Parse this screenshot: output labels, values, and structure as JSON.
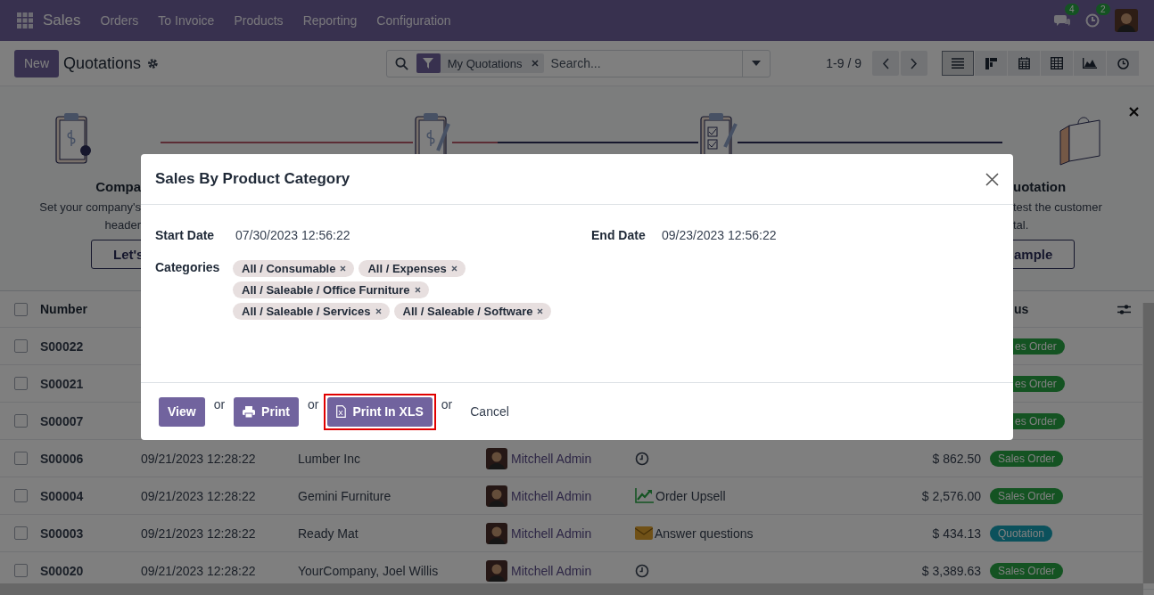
{
  "navbar": {
    "app": "Sales",
    "menu": [
      "Orders",
      "To Invoice",
      "Products",
      "Reporting",
      "Configuration"
    ],
    "messages_count": "4",
    "activities_count": "2"
  },
  "control_panel": {
    "new_button": "New",
    "title": "Quotations",
    "search": {
      "facet": "My Quotations",
      "placeholder": "Search..."
    },
    "pager": "1-9 / 9",
    "views": [
      {
        "kind": "list",
        "selected": true
      },
      {
        "kind": "kanban",
        "selected": false
      },
      {
        "kind": "calendar",
        "selected": false
      },
      {
        "kind": "pivot",
        "selected": false
      },
      {
        "kind": "graph",
        "selected": false
      },
      {
        "kind": "activity",
        "selected": false
      }
    ]
  },
  "onboarding_banner": {
    "left_step": {
      "title": "Compa",
      "description": [
        "Set your company's",
        "header"
      ],
      "button": "Let's"
    },
    "right_step": {
      "title": "uotation",
      "description": [
        "test the customer",
        "tal."
      ],
      "button": "ample"
    }
  },
  "table": {
    "select_all_checked": false,
    "columns": [
      "Number",
      "us"
    ],
    "rows": [
      {
        "checked": false,
        "number": "S00022",
        "status": {
          "kind": "sales_order",
          "label": "es Order",
          "partial": true
        }
      },
      {
        "checked": false,
        "number": "S00021",
        "status": {
          "kind": "sales_order",
          "label": "es Order",
          "partial": true
        }
      },
      {
        "checked": false,
        "number": "S00007",
        "status": {
          "kind": "sales_order",
          "label": "es Order",
          "partial": true
        }
      },
      {
        "checked": false,
        "number": "S00006",
        "date": "09/21/2023 12:28:22",
        "customer": "Lumber Inc",
        "salesperson": "Mitchell Admin",
        "activity": {
          "kind": "clock"
        },
        "total": "$ 862.50",
        "status": {
          "kind": "sales_order",
          "label": "Sales Order",
          "partial": false
        }
      },
      {
        "checked": false,
        "number": "S00004",
        "date": "09/21/2023 12:28:22",
        "customer": "Gemini Furniture",
        "salesperson": "Mitchell Admin",
        "activity": {
          "kind": "upsell",
          "label": "Order Upsell"
        },
        "total": "$ 2,576.00",
        "status": {
          "kind": "sales_order",
          "label": "Sales Order",
          "partial": false
        }
      },
      {
        "checked": false,
        "number": "S00003",
        "date": "09/21/2023 12:28:22",
        "customer": "Ready Mat",
        "salesperson": "Mitchell Admin",
        "activity": {
          "kind": "email",
          "label": "Answer questions"
        },
        "total": "$ 434.13",
        "status": {
          "kind": "quotation",
          "label": "Quotation",
          "partial": false
        }
      },
      {
        "checked": false,
        "number": "S00020",
        "date": "09/21/2023 12:28:22",
        "customer": "YourCompany, Joel Willis",
        "salesperson": "Mitchell Admin",
        "activity": {
          "kind": "clock"
        },
        "total": "$ 3,389.63",
        "status": {
          "kind": "sales_order",
          "label": "Sales Order",
          "partial": false
        }
      }
    ]
  },
  "dialog": {
    "title": "Sales By Product Category",
    "start_date": {
      "label": "Start Date",
      "value": "07/30/2023 12:56:22"
    },
    "end_date": {
      "label": "End Date",
      "value": "09/23/2023 12:56:22"
    },
    "categories": {
      "label": "Categories",
      "tags": [
        "All / Consumable",
        "All / Expenses",
        "All / Saleable / Office Furniture",
        "All / Saleable / Services",
        "All / Saleable / Software"
      ]
    },
    "actions": [
      {
        "kind": "primary",
        "label": "View",
        "highlighted": false
      },
      {
        "kind": "separator",
        "label": "or"
      },
      {
        "kind": "print",
        "label": "Print",
        "highlighted": false
      },
      {
        "kind": "separator",
        "label": "or"
      },
      {
        "kind": "xls",
        "label": "Print In XLS",
        "highlighted": true
      },
      {
        "kind": "separator",
        "label": "or"
      },
      {
        "kind": "link",
        "label": "Cancel",
        "highlighted": false
      }
    ]
  }
}
